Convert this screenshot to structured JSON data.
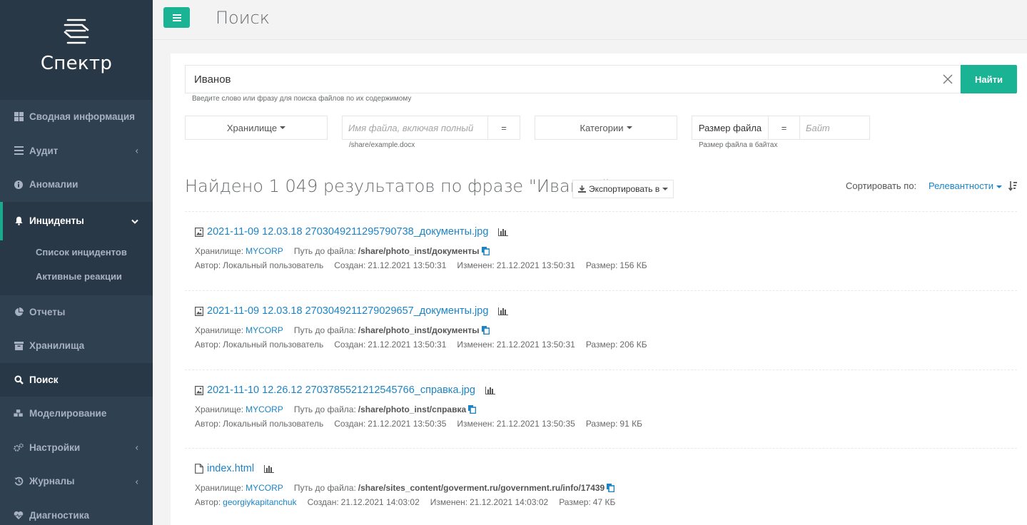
{
  "app": {
    "name": "Спектр"
  },
  "sidebar": {
    "items": [
      {
        "label": "Сводная информация"
      },
      {
        "label": "Аудит"
      },
      {
        "label": "Аномалии"
      },
      {
        "label": "Инциденты"
      },
      {
        "label": "Отчеты"
      },
      {
        "label": "Хранилища"
      },
      {
        "label": "Поиск"
      },
      {
        "label": "Моделирование"
      },
      {
        "label": "Настройки"
      },
      {
        "label": "Журналы"
      },
      {
        "label": "Диагностика"
      }
    ],
    "incidents_sub": [
      {
        "label": "Список инцидентов"
      },
      {
        "label": "Активные реакции"
      }
    ]
  },
  "header": {
    "title": "Поиск"
  },
  "search": {
    "value": "Иванов",
    "button": "Найти",
    "help": "Введите слово или фразу для поиска файлов по их содержимому"
  },
  "filters": {
    "storage": "Хранилище",
    "filename_placeholder": "Имя файла, включая полный",
    "filename_op": "=",
    "filename_help": "/share/example.docx",
    "categories": "Категории",
    "size_label": "Размер файла",
    "size_op": "=",
    "size_placeholder": "Байт",
    "size_help": "Размер файла в байтах"
  },
  "results": {
    "heading": "Найдено 1 049 результатов по фразе \"Иванов\"",
    "export": "Экспортировать в",
    "sort_label": "Сортировать по:",
    "sort_value": "Релевантности",
    "labels": {
      "storage": "Хранилище:",
      "path": "Путь до файла:",
      "author": "Автор:",
      "created": "Создан:",
      "modified": "Изменен:",
      "size": "Размер:"
    },
    "items": [
      {
        "name": "2021-11-09 12.03.18 2703049211295790738_документы.jpg",
        "storage": "MYCORP",
        "path": "/share/photo_inst/документы",
        "author": "Локальный пользователь",
        "created": "21.12.2021 13:50:31",
        "modified": "21.12.2021 13:50:31",
        "size": "156 КБ"
      },
      {
        "name": "2021-11-09 12.03.18 2703049211279029657_документы.jpg",
        "storage": "MYCORP",
        "path": "/share/photo_inst/документы",
        "author": "Локальный пользователь",
        "created": "21.12.2021 13:50:31",
        "modified": "21.12.2021 13:50:31",
        "size": "206 КБ"
      },
      {
        "name": "2021-11-10 12.26.12 2703785521212545766_справка.jpg",
        "storage": "MYCORP",
        "path": "/share/photo_inst/справка",
        "author": "Локальный пользователь",
        "created": "21.12.2021 13:50:35",
        "modified": "21.12.2021 13:50:35",
        "size": "91 КБ"
      },
      {
        "name": "index.html",
        "storage": "MYCORP",
        "path": "/share/sites_content/goverment.ru/government.ru/info/17439",
        "author": "georgiykapitanchuk",
        "created": "21.12.2021 14:03:02",
        "modified": "21.12.2021 14:03:02",
        "size": "47 КБ"
      }
    ]
  },
  "colors": {
    "sidebar": "#2f4050",
    "sidebar_dark": "#293846",
    "accent": "#1ab394",
    "link": "#1c84c6"
  }
}
